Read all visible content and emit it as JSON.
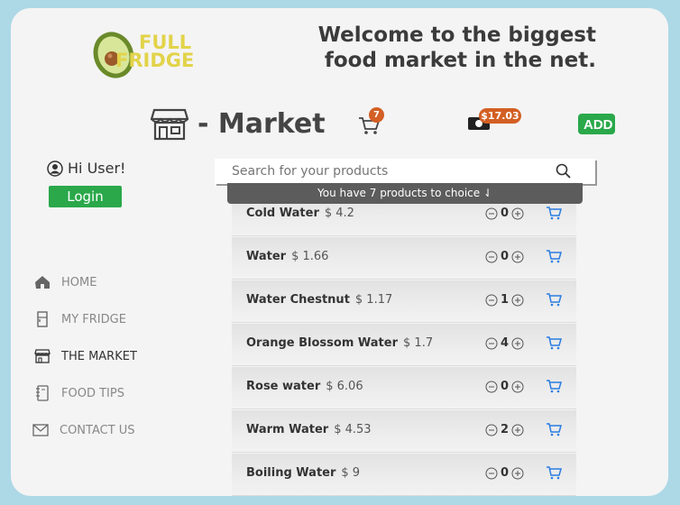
{
  "header": {
    "logo_line1": "FULL",
    "logo_line2": "FRIDGE",
    "welcome": "Welcome to the biggest food market in the net."
  },
  "market": {
    "title": "- Market",
    "cart_count": "7",
    "balance": "$17.03",
    "add_label": "ADD"
  },
  "user": {
    "greeting": "Hi User!",
    "login_label": "Login"
  },
  "nav": [
    {
      "label": "HOME",
      "icon": "home-icon"
    },
    {
      "label": "MY FRIDGE",
      "icon": "fridge-icon"
    },
    {
      "label": "THE MARKET",
      "icon": "store-icon"
    },
    {
      "label": "FOOD TIPS",
      "icon": "notebook-icon"
    },
    {
      "label": "CONTACT US",
      "icon": "envelope-icon"
    }
  ],
  "search": {
    "placeholder": "Search for your products",
    "hint": "You have 7 products to choice ⇃"
  },
  "products": [
    {
      "name": "Cold Water",
      "price": "$ 4.2",
      "qty": "0"
    },
    {
      "name": "Water",
      "price": "$ 1.66",
      "qty": "0"
    },
    {
      "name": "Water Chestnut",
      "price": "$ 1.17",
      "qty": "1"
    },
    {
      "name": "Orange Blossom Water",
      "price": "$ 1.7",
      "qty": "4"
    },
    {
      "name": "Rose water",
      "price": "$ 6.06",
      "qty": "0"
    },
    {
      "name": "Warm Water",
      "price": "$ 4.53",
      "qty": "2"
    },
    {
      "name": "Boiling Water",
      "price": "$ 9",
      "qty": "0"
    }
  ],
  "colors": {
    "accent_green": "#2aa84a",
    "badge_orange": "#d35f24",
    "cart_blue": "#2a7de1",
    "logo_yellow": "#e2d34a"
  }
}
